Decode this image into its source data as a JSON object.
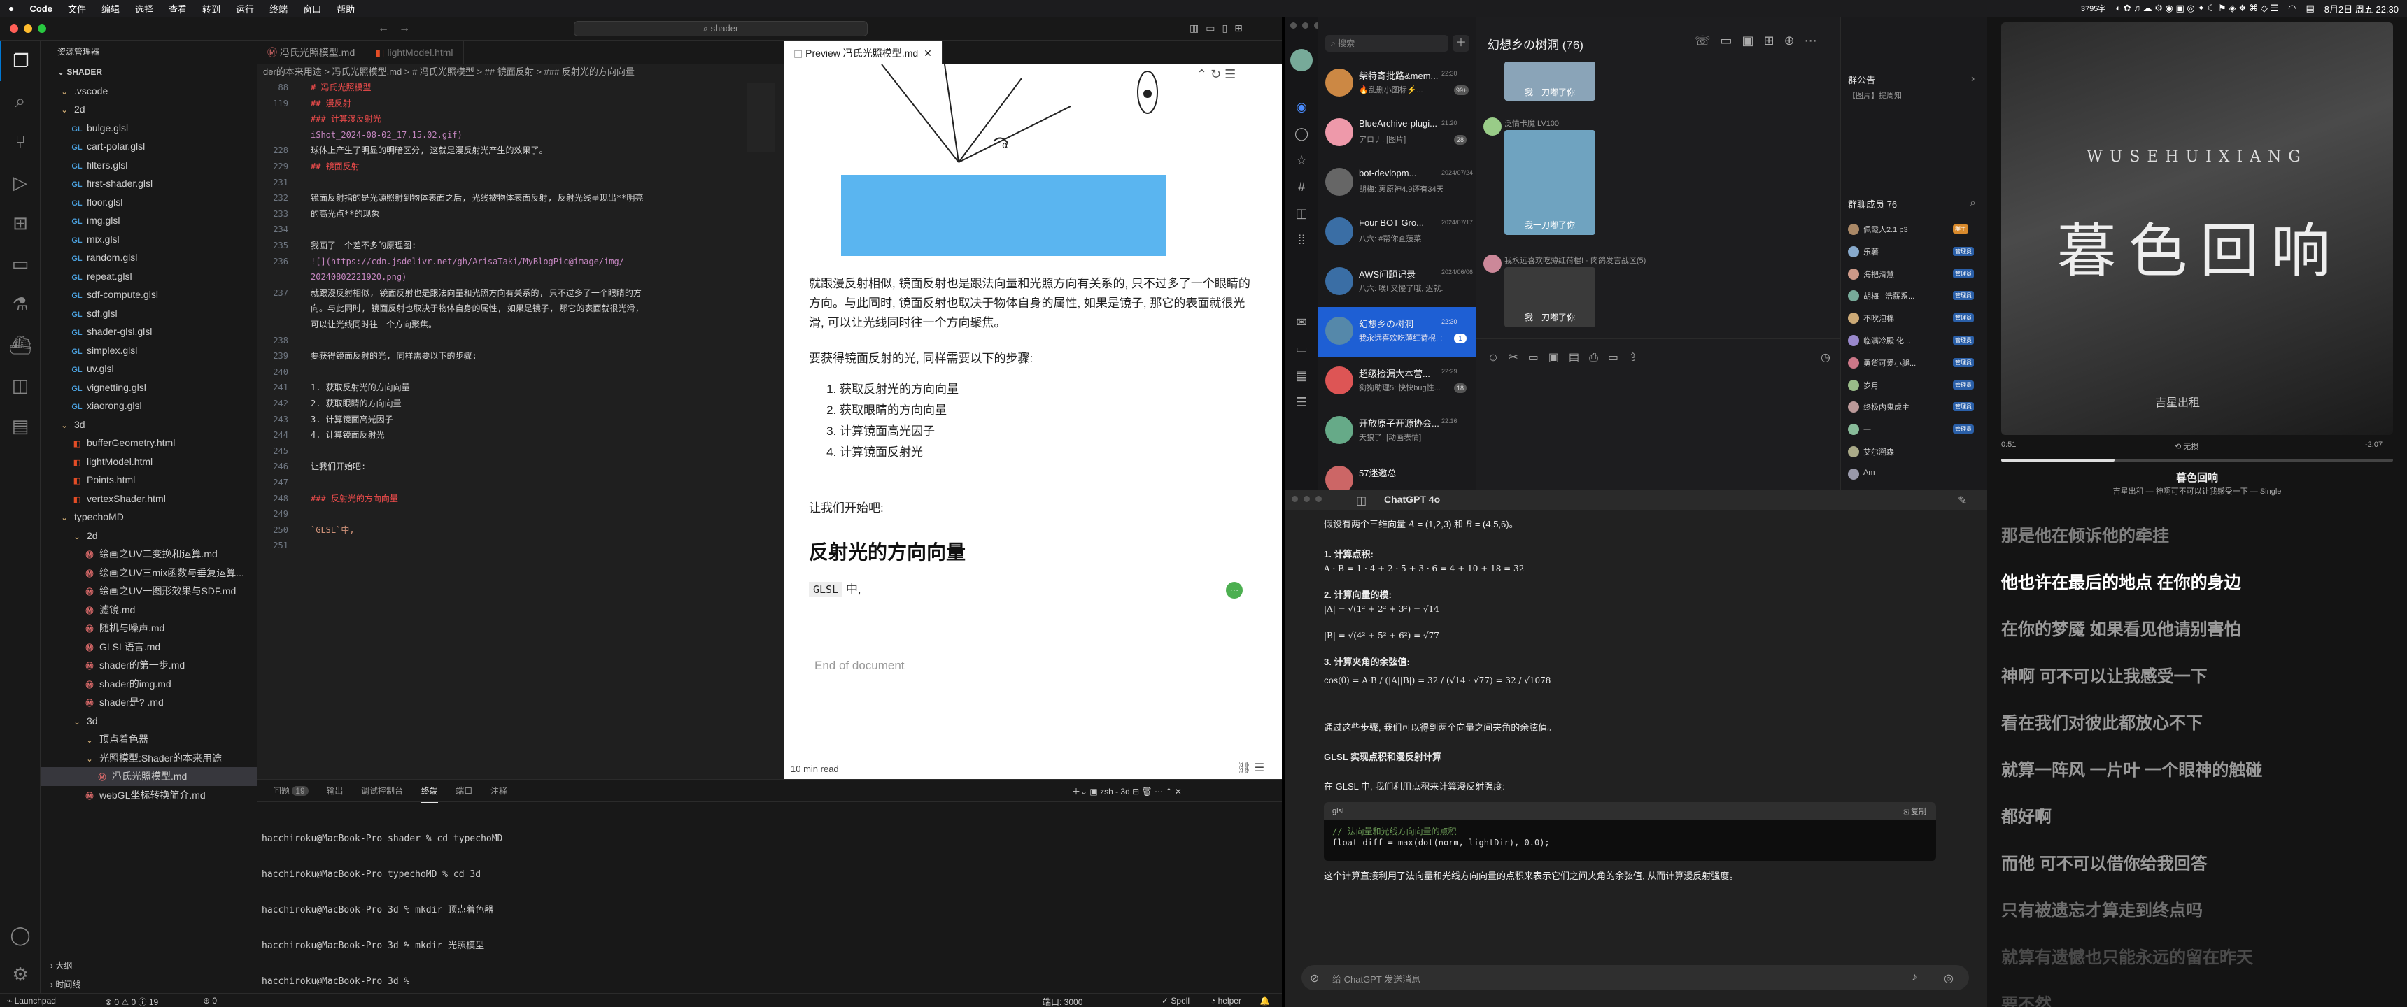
{
  "menubar": {
    "app_name": "Code",
    "items": [
      "文件",
      "编辑",
      "选择",
      "查看",
      "转到",
      "运行",
      "终端",
      "窗口",
      "帮助"
    ],
    "net_speed": "3795字",
    "datetime": "8月2日 周五 22:30"
  },
  "vscode": {
    "command_center": "shader",
    "explorer_title": "资源管理器",
    "root_folder": "SHADER",
    "tree": [
      {
        "label": ".vscode",
        "type": "folder",
        "indent": 0
      },
      {
        "label": "2d",
        "type": "folder",
        "indent": 0
      },
      {
        "label": "bulge.glsl",
        "type": "glsl",
        "indent": 1
      },
      {
        "label": "cart-polar.glsl",
        "type": "glsl",
        "indent": 1
      },
      {
        "label": "filters.glsl",
        "type": "glsl",
        "indent": 1
      },
      {
        "label": "first-shader.glsl",
        "type": "glsl",
        "indent": 1
      },
      {
        "label": "floor.glsl",
        "type": "glsl",
        "indent": 1
      },
      {
        "label": "img.glsl",
        "type": "glsl",
        "indent": 1
      },
      {
        "label": "mix.glsl",
        "type": "glsl",
        "indent": 1
      },
      {
        "label": "random.glsl",
        "type": "glsl",
        "indent": 1
      },
      {
        "label": "repeat.glsl",
        "type": "glsl",
        "indent": 1
      },
      {
        "label": "sdf-compute.glsl",
        "type": "glsl",
        "indent": 1
      },
      {
        "label": "sdf.glsl",
        "type": "glsl",
        "indent": 1
      },
      {
        "label": "shader-glsl.glsl",
        "type": "glsl",
        "indent": 1
      },
      {
        "label": "simplex.glsl",
        "type": "glsl",
        "indent": 1
      },
      {
        "label": "uv.glsl",
        "type": "glsl",
        "indent": 1
      },
      {
        "label": "vignetting.glsl",
        "type": "glsl",
        "indent": 1
      },
      {
        "label": "xiaorong.glsl",
        "type": "glsl",
        "indent": 1
      },
      {
        "label": "3d",
        "type": "folder",
        "indent": 0
      },
      {
        "label": "bufferGeometry.html",
        "type": "html",
        "indent": 1
      },
      {
        "label": "lightModel.html",
        "type": "html",
        "indent": 1
      },
      {
        "label": "Points.html",
        "type": "html",
        "indent": 1
      },
      {
        "label": "vertexShader.html",
        "type": "html",
        "indent": 1
      },
      {
        "label": "typechoMD",
        "type": "folder",
        "indent": 0
      },
      {
        "label": "2d",
        "type": "folder",
        "indent": 1
      },
      {
        "label": "绘画之UV二变换和运算.md",
        "type": "md",
        "indent": 2
      },
      {
        "label": "绘画之UV三mix函数与垂复运算...",
        "type": "md",
        "indent": 2
      },
      {
        "label": "绘画之UV一图形效果与SDF.md",
        "type": "md",
        "indent": 2
      },
      {
        "label": "滤镜.md",
        "type": "md",
        "indent": 2
      },
      {
        "label": "随机与噪声.md",
        "type": "md",
        "indent": 2
      },
      {
        "label": "GLSL语言.md",
        "type": "md",
        "indent": 2
      },
      {
        "label": "shader的第一步.md",
        "type": "md",
        "indent": 2
      },
      {
        "label": "shader的img.md",
        "type": "md",
        "indent": 2
      },
      {
        "label": "shader是? .md",
        "type": "md",
        "indent": 2
      },
      {
        "label": "3d",
        "type": "folder",
        "indent": 1
      },
      {
        "label": "顶点着色器",
        "type": "folder",
        "indent": 2
      },
      {
        "label": "光照模型:Shader的本来用途",
        "type": "folder",
        "indent": 2
      },
      {
        "label": "冯氏光照模型.md",
        "type": "md",
        "indent": 3,
        "selected": true
      },
      {
        "label": "webGL坐标转换简介.md",
        "type": "md",
        "indent": 2
      }
    ],
    "outline_label": "大纲",
    "timeline_label": "时间线",
    "editor_tabs": [
      {
        "label": "冯氏光照模型.md",
        "active": false
      },
      {
        "label": "lightModel.html",
        "active": false
      }
    ],
    "breadcrumb": "der的本来用途 > 冯氏光照模型.md > # 冯氏光照模型 > ## 镜面反射 > ### 反射光的方向向量",
    "code_lines": [
      {
        "num": "88",
        "text": "# 冯氏光照模型",
        "cls": "c-red"
      },
      {
        "num": "119",
        "text": "## 漫反射",
        "cls": "c-red"
      },
      {
        "num": "",
        "text": "### 计算漫反射光",
        "cls": "c-red"
      },
      {
        "num": "",
        "text": "iShot_2024-08-02_17.15.02.gif)",
        "cls": "c-link"
      },
      {
        "num": "228",
        "text": "球体上产生了明显的明暗区分, 这就是漫反射光产生的效果了。",
        "cls": "c-txt"
      },
      {
        "num": "229",
        "text": "## 镜面反射",
        "cls": "c-red"
      },
      {
        "num": "231",
        "text": "",
        "cls": "c-txt"
      },
      {
        "num": "232",
        "text": "镜面反射指的是光源照射到物体表面之后, 光线被物体表面反射, 反射光线呈现出**明亮",
        "cls": "c-txt"
      },
      {
        "num": "233",
        "text": "的高光点**的现象",
        "cls": "c-txt"
      },
      {
        "num": "234",
        "text": "",
        "cls": "c-txt"
      },
      {
        "num": "235",
        "text": "我画了一个差不多的原理图:",
        "cls": "c-txt"
      },
      {
        "num": "236",
        "text": "![](https://cdn.jsdelivr.net/gh/ArisaTaki/MyBlogPic@image/img/",
        "cls": "c-link"
      },
      {
        "num": "",
        "text": "20240802221920.png)",
        "cls": "c-link"
      },
      {
        "num": "237",
        "text": "就跟漫反射相似, 镜面反射也是跟法向量和光照方向有关系的, 只不过多了一个眼睛的方",
        "cls": "c-txt"
      },
      {
        "num": "",
        "text": "向。与此同时, 镜面反射也取决于物体自身的属性, 如果是镜子, 那它的表面就很光滑,",
        "cls": "c-txt"
      },
      {
        "num": "",
        "text": "可以让光线同时往一个方向聚焦。",
        "cls": "c-txt"
      },
      {
        "num": "238",
        "text": "",
        "cls": "c-txt"
      },
      {
        "num": "239",
        "text": "要获得镜面反射的光, 同样需要以下的步骤:",
        "cls": "c-txt"
      },
      {
        "num": "240",
        "text": "",
        "cls": "c-txt"
      },
      {
        "num": "241",
        "text": "1. 获取反射光的方向向量",
        "cls": "c-txt"
      },
      {
        "num": "242",
        "text": "2. 获取眼睛的方向向量",
        "cls": "c-txt"
      },
      {
        "num": "243",
        "text": "3. 计算镜面高光因子",
        "cls": "c-txt"
      },
      {
        "num": "244",
        "text": "4. 计算镜面反射光",
        "cls": "c-txt"
      },
      {
        "num": "245",
        "text": "",
        "cls": "c-txt"
      },
      {
        "num": "246",
        "text": "让我们开始吧:",
        "cls": "c-txt"
      },
      {
        "num": "247",
        "text": "",
        "cls": "c-txt"
      },
      {
        "num": "248",
        "text": "### 反射光的方向向量",
        "cls": "c-red"
      },
      {
        "num": "249",
        "text": "",
        "cls": "c-txt"
      },
      {
        "num": "250",
        "text": "`GLSL`中,",
        "cls": "c-or"
      },
      {
        "num": "251",
        "text": "",
        "cls": "c-txt"
      }
    ],
    "preview": {
      "tab_label": "Preview 冯氏光照模型.md",
      "para1": "就跟漫反射相似, 镜面反射也是跟法向量和光照方向有关系的, 只不过多了一个眼睛的方向。与此同时, 镜面反射也取决于物体自身的属性, 如果是镜子, 那它的表面就很光滑, 可以让光线同时往一个方向聚焦。",
      "para2": "要获得镜面反射的光, 同样需要以下的步骤:",
      "steps": [
        "获取反射光的方向向量",
        "获取眼睛的方向向量",
        "计算镜面高光因子",
        "计算镜面反射光"
      ],
      "para3": "让我们开始吧:",
      "heading": "反射光的方向向量",
      "code_inline": "GLSL",
      "after_code": " 中,",
      "end_doc": "End of document",
      "read_time": "10 min read"
    },
    "panel": {
      "tabs": [
        "问题",
        "输出",
        "调试控制台",
        "终端",
        "端口",
        "注释"
      ],
      "problems_count": "19",
      "shell_label": "zsh - 3d",
      "terminal_lines": [
        "hacchiroku@MacBook-Pro shader % cd typechoMD",
        "hacchiroku@MacBook-Pro typechoMD % cd 3d",
        "hacchiroku@MacBook-Pro 3d % mkdir 顶点着色器",
        "hacchiroku@MacBook-Pro 3d % mkdir 光照模型",
        "hacchiroku@MacBook-Pro 3d % "
      ]
    },
    "status": {
      "left": "Launchpad",
      "errors": "0",
      "warnings": "0",
      "info": "19",
      "ports": "0",
      "port_label": "端口: 3000",
      "spell": "Spell",
      "helper": "helper"
    }
  },
  "qq": {
    "search_placeholder": "搜索",
    "chat_title": "幻想乡の树洞 (76)",
    "conversations": [
      {
        "name": "柴特寄批路&mem...",
        "time": "22:30",
        "preview": "🔥乱删小图标⚡️...",
        "badge": "99+"
      },
      {
        "name": "BlueArchive-plugi...",
        "time": "21:20",
        "preview": "アロナ: [图片]",
        "badge": "28"
      },
      {
        "name": "bot-devlopm...",
        "time": "2024/07/24",
        "preview": "胡梅: 裏原神4.9还有34天2...",
        "badge": ""
      },
      {
        "name": "Four BOT Gro...",
        "time": "2024/07/17",
        "preview": "八六: #帮你查菠菜",
        "badge": ""
      },
      {
        "name": "AWS问题记录",
        "time": "2024/06/06",
        "preview": "八六: 唉! 又慢了哦, 迟就...",
        "badge": ""
      },
      {
        "name": "幻想乡の树洞",
        "time": "22:30",
        "preview": "我永远喜欢吃薄红荷棍! : ...",
        "badge": "1",
        "active": true
      },
      {
        "name": "超级捡漏大本营...",
        "time": "22:29",
        "preview": "狗狗助理5: 快快bug性...",
        "badge": "18"
      },
      {
        "name": "开放原子开源协会...",
        "time": "22:16",
        "preview": "天狼了: [动画表情]",
        "badge": ""
      },
      {
        "name": "57迷邀总",
        "time": "",
        "preview": "",
        "badge": ""
      }
    ],
    "messages": [
      {
        "sender": "",
        "sticker_text": "我一刀嘟了你"
      },
      {
        "sender": "泛情卡魔 LV100",
        "sticker_text": "我一刀嘟了你"
      },
      {
        "sender": "我永远喜欢吃薄红荷棍! · 肉鸽发言战区(5)",
        "sticker_text": "我一刀嘟了你"
      }
    ],
    "group_notice_title": "群公告",
    "group_notice_text": "【图片】提周知",
    "members_title": "群聊成员 76",
    "members": [
      {
        "name": "佩霞人2.1 p3",
        "tag": "群主"
      },
      {
        "name": "乐薯",
        "tag": "管理员"
      },
      {
        "name": "海把滑慧",
        "tag": "管理员"
      },
      {
        "name": "胡梅 | 浩薪系...",
        "tag": "管理员"
      },
      {
        "name": "不吹泡棉",
        "tag": "管理员"
      },
      {
        "name": "临满冷殿 化...",
        "tag": "管理员"
      },
      {
        "name": "勇货可爱小腿...",
        "tag": "管理员"
      },
      {
        "name": "岁月",
        "tag": "管理员"
      },
      {
        "name": "终极内鬼虎主",
        "tag": "管理员"
      },
      {
        "name": "一",
        "tag": "管理员"
      },
      {
        "name": "艾尔溯森",
        "tag": ""
      },
      {
        "name": "Am",
        "tag": ""
      }
    ]
  },
  "chatgpt": {
    "title": "ChatGPT 4o",
    "intro": "假设有两个三维向量",
    "step1": "1. 计算点积:",
    "dot_formula": "A · B = 1 · 4 + 2 · 5 + 3 · 6 = 4 + 10 + 18 = 32",
    "step2": "2. 计算向量的模:",
    "mag_a": "|A| = √(1² + 2² + 3²) = √14",
    "mag_b": "|B| = √(4² + 5² + 6²) = √77",
    "step3": "3. 计算夹角的余弦值:",
    "cos_formula": "cos(θ) = A·B / (|A||B|) = 32 / (√14 · √77) = 32 / √1078",
    "summary": "通过这些步骤, 我们可以得到两个向量之间夹角的余弦值。",
    "section_title": "GLSL 实现点积和漫反射计算",
    "section_text": "在 GLSL 中, 我们利用点积来计算漫反射强度:",
    "code_lang": "glsl",
    "copy_label": "复制",
    "code_comment": "// 法向量和光线方向向量的点积",
    "code_line": "float diff = max(dot(norm, lightDir), 0.0);",
    "bottom_text": "这个计算直接利用了法向量和光线方向向量的点积来表示它们之间夹角的余弦值, 从而计算漫反射强度。",
    "input_placeholder": "给 ChatGPT 发送消息"
  },
  "music": {
    "cover_title": "WUSEHUIXIANG",
    "cover_chars": "暮色回响",
    "publisher_tag": "吉星出租",
    "time_elapsed": "0:51",
    "time_remaining": "-2:07",
    "progress_pct": 29,
    "mode_label": "无损",
    "song_title": "暮色回响",
    "song_subtitle": "吉星出租 — 神啊可不可以让我感受一下 — Single",
    "lyrics": [
      {
        "text": "那是他在倾诉他的牵挂",
        "state": "past"
      },
      {
        "text": "他也许在最后的地点 在你的身边",
        "state": "current"
      },
      {
        "text": "在你的梦魇 如果看见他请别害怕",
        "state": "future"
      },
      {
        "text": "神啊 可不可以让我感受一下",
        "state": "future"
      },
      {
        "text": "看在我们对彼此都放心不下",
        "state": "future"
      },
      {
        "text": "就算一阵风 一片叶 一个眼神的触碰",
        "state": "future"
      },
      {
        "text": "都好啊",
        "state": "future"
      },
      {
        "text": "而他 可不可以借你给我回答",
        "state": "future"
      },
      {
        "text": "只有被遗忘才算走到终点吗",
        "state": "future2"
      },
      {
        "text": "就算有遗憾也只能永远的留在昨天",
        "state": "future3"
      },
      {
        "text": "要不然",
        "state": "future3"
      }
    ]
  }
}
